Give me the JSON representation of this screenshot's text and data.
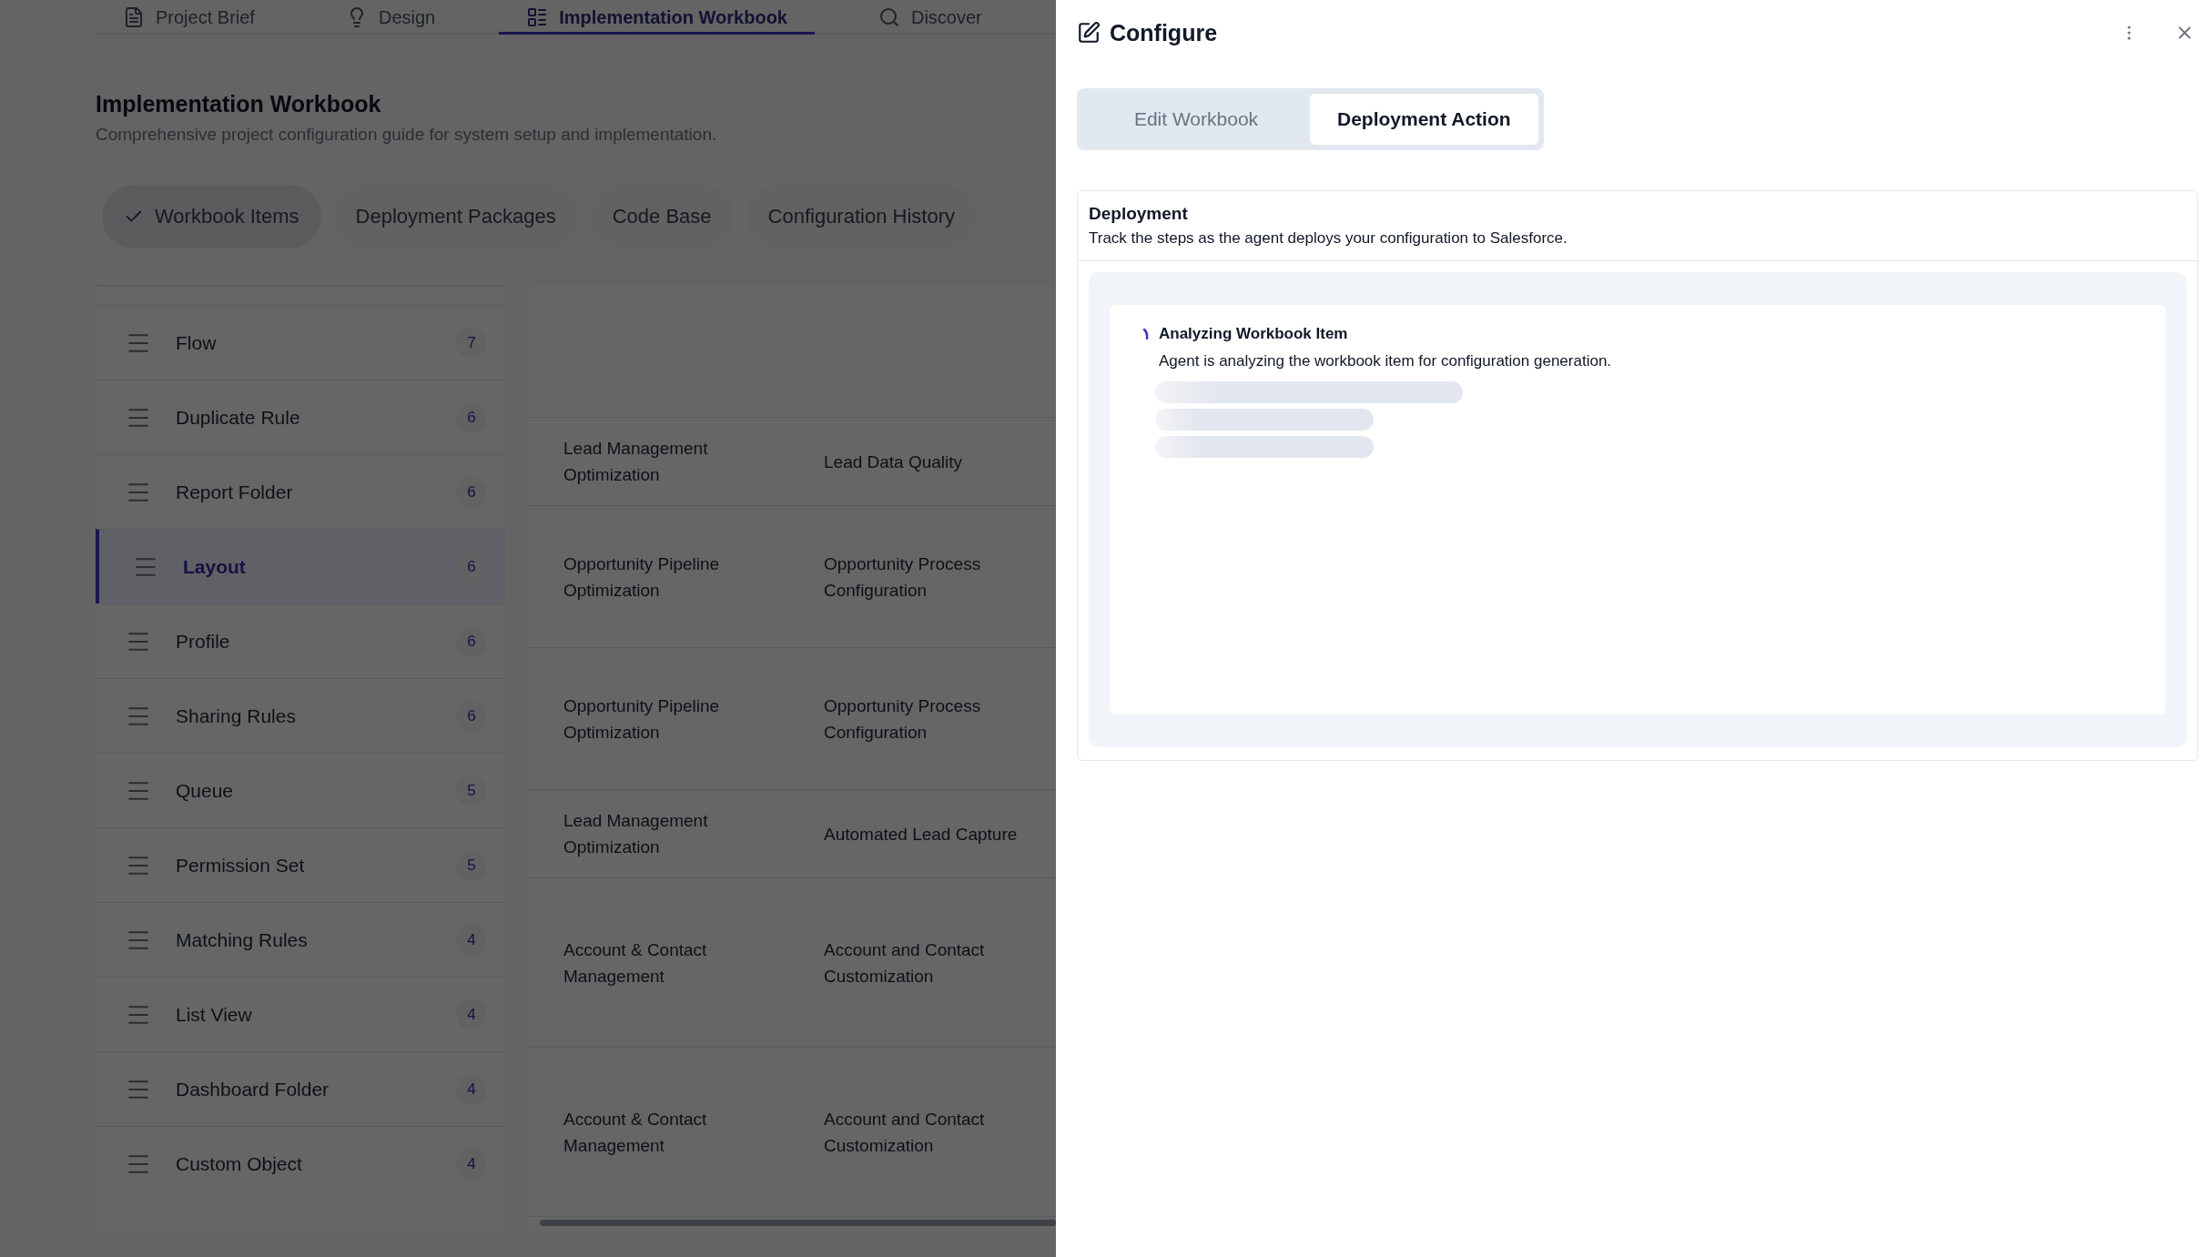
{
  "nav_tabs": [
    {
      "label": "Project Brief",
      "selected": false
    },
    {
      "label": "Design",
      "selected": false
    },
    {
      "label": "Implementation Workbook",
      "selected": true
    },
    {
      "label": "Discover",
      "selected": false
    }
  ],
  "page": {
    "title": "Implementation Workbook",
    "subtitle": "Comprehensive project configuration guide for system setup and implementation."
  },
  "section_tabs": [
    {
      "label": "Workbook Items",
      "selected": true
    },
    {
      "label": "Deployment Packages",
      "selected": false
    },
    {
      "label": "Code Base",
      "selected": false
    },
    {
      "label": "Configuration History",
      "selected": false
    }
  ],
  "sidebar": {
    "items": [
      {
        "label": "Flow",
        "count": "7",
        "selected": false
      },
      {
        "label": "Duplicate Rule",
        "count": "6",
        "selected": false
      },
      {
        "label": "Report Folder",
        "count": "6",
        "selected": false
      },
      {
        "label": "Layout",
        "count": "6",
        "selected": true
      },
      {
        "label": "Profile",
        "count": "6",
        "selected": false
      },
      {
        "label": "Sharing Rules",
        "count": "6",
        "selected": false
      },
      {
        "label": "Queue",
        "count": "5",
        "selected": false
      },
      {
        "label": "Permission Set",
        "count": "5",
        "selected": false
      },
      {
        "label": "Matching Rules",
        "count": "4",
        "selected": false
      },
      {
        "label": "List View",
        "count": "4",
        "selected": false
      },
      {
        "label": "Dashboard Folder",
        "count": "4",
        "selected": false
      },
      {
        "label": "Custom Object",
        "count": "4",
        "selected": false
      }
    ]
  },
  "table": {
    "rows": [
      {
        "column_1": "Lead Management Optimization",
        "column_2": "Lead Data Quality"
      },
      {
        "column_1": "Opportunity Pipeline Optimization",
        "column_2": "Opportunity Process Configuration"
      },
      {
        "column_1": "Opportunity Pipeline Optimization",
        "column_2": "Opportunity Process Configuration"
      },
      {
        "column_1": "Lead Management Optimization",
        "column_2": "Automated Lead Capture"
      },
      {
        "column_1": "Account & Contact Management",
        "column_2": "Account and Contact Customization"
      },
      {
        "column_1": "Account & Contact Management",
        "column_2": "Account and Contact Customization"
      }
    ]
  },
  "panel": {
    "title": "Configure",
    "mode_tabs": [
      {
        "label": "Edit Workbook",
        "selected": false
      },
      {
        "label": "Deployment Action",
        "selected": true
      }
    ],
    "card": {
      "title": "Deployment",
      "description": "Track the steps as the agent deploys your configuration to Salesforce.",
      "step": {
        "title": "Analyzing Workbook Item",
        "description": "Agent is analyzing the workbook item for configuration generation."
      }
    }
  }
}
